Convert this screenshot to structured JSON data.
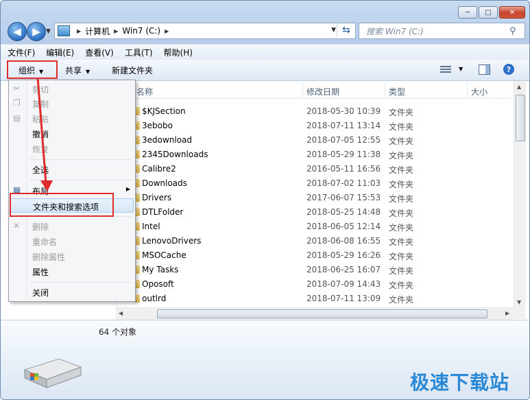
{
  "title_buttons": {
    "minimize": "─",
    "maximize": "□",
    "close": "✕"
  },
  "address": {
    "segments": [
      "计算机",
      "Win7 (C:)"
    ],
    "search_placeholder": "搜索 Win7 (C:)"
  },
  "menubar": [
    "文件(F)",
    "编辑(E)",
    "查看(V)",
    "工具(T)",
    "帮助(H)"
  ],
  "toolbar": {
    "organize": "组织",
    "share": "共享",
    "new_folder": "新建文件夹",
    "help": "?"
  },
  "columns": {
    "name": "名称",
    "date": "修改日期",
    "type": "类型",
    "size": "大小"
  },
  "rows": [
    {
      "name": "$KJSection",
      "date": "2018-05-30 10:39",
      "type": "文件夹"
    },
    {
      "name": "3ebobo",
      "date": "2018-07-11 13:14",
      "type": "文件夹"
    },
    {
      "name": "3edownload",
      "date": "2018-07-05 12:55",
      "type": "文件夹"
    },
    {
      "name": "2345Downloads",
      "date": "2018-05-29 11:38",
      "type": "文件夹"
    },
    {
      "name": "Calibre2",
      "date": "2016-05-11 16:56",
      "type": "文件夹"
    },
    {
      "name": "Downloads",
      "date": "2018-07-02 11:03",
      "type": "文件夹"
    },
    {
      "name": "Drivers",
      "date": "2017-06-07 15:53",
      "type": "文件夹"
    },
    {
      "name": "DTLFolder",
      "date": "2018-05-25 14:48",
      "type": "文件夹"
    },
    {
      "name": "Intel",
      "date": "2018-06-05 12:14",
      "type": "文件夹"
    },
    {
      "name": "LenovoDrivers",
      "date": "2018-06-08 16:55",
      "type": "文件夹"
    },
    {
      "name": "MSOCache",
      "date": "2018-05-29 16:26",
      "type": "文件夹"
    },
    {
      "name": "My Tasks",
      "date": "2018-06-25 16:07",
      "type": "文件夹"
    },
    {
      "name": "Oposoft",
      "date": "2018-07-09 14:43",
      "type": "文件夹"
    },
    {
      "name": "outlrd",
      "date": "2018-07-11 13:09",
      "type": "文件夹"
    }
  ],
  "org_menu": {
    "cut": "剪切",
    "copy": "复制",
    "paste": "粘贴",
    "undo": "撤消",
    "redo": "恢复",
    "select_all": "全选",
    "layout": "布局",
    "folder_options": "文件夹和搜索选项",
    "delete": "删除",
    "rename": "重命名",
    "remove_props": "删除属性",
    "properties": "属性",
    "close": "关闭"
  },
  "status": {
    "count": "64 个对象"
  },
  "watermark": "极速下载站",
  "colors": {
    "highlight": "#e02b2b",
    "accent": "#2a89d6"
  }
}
